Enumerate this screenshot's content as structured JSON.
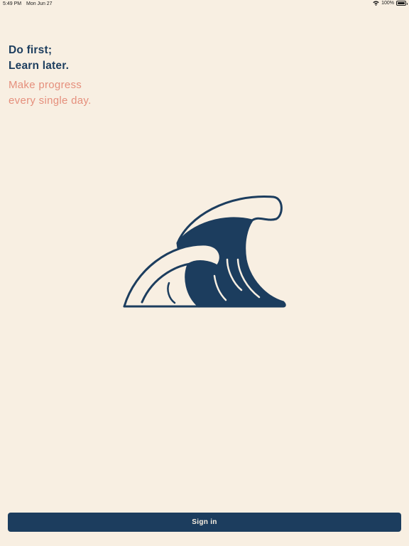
{
  "status_bar": {
    "time": "5:49 PM",
    "date": "Mon Jun 27",
    "battery": "100%",
    "battery_level": 1.0
  },
  "headline": {
    "line1": "Do first;",
    "line2": "Learn later."
  },
  "tagline": {
    "line1": "Make progress",
    "line2": "every single day."
  },
  "logo": {
    "icon": "wave-icon",
    "color": "#1c3d5e"
  },
  "sign_in_button": {
    "label": "Sign in"
  },
  "colors": {
    "background": "#f8efe2",
    "primary": "#1c3d5e",
    "accent": "#e58f7c"
  }
}
